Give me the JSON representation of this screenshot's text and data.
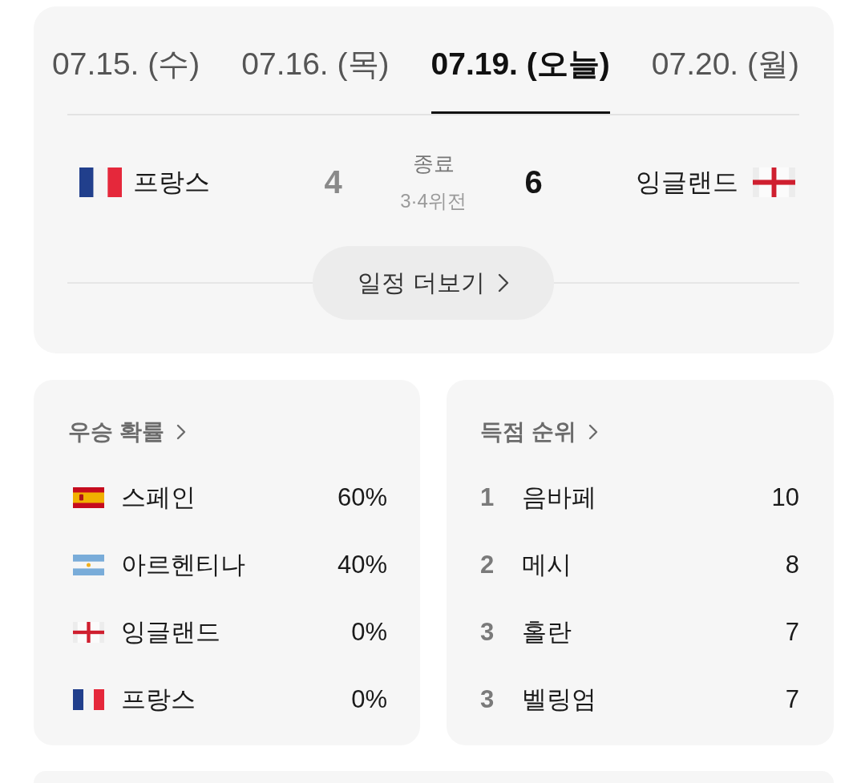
{
  "date_tabs": [
    {
      "label": "07.15. (수)",
      "selected": false
    },
    {
      "label": "07.16. (목)",
      "selected": false
    },
    {
      "label": "07.19. (오늘)",
      "selected": true
    },
    {
      "label": "07.20. (월)",
      "selected": false
    }
  ],
  "match": {
    "home": {
      "kind": "france",
      "name": "프랑스",
      "score": "4",
      "winner": false
    },
    "status": "종료",
    "round": "3·4위전",
    "away": {
      "kind": "england",
      "name": "잉글랜드",
      "score": "6",
      "winner": true
    }
  },
  "schedule_button": {
    "label": "일정 더보기"
  },
  "win_probability": {
    "title": "우승 확률",
    "rows": [
      {
        "kind": "spain",
        "name": "스페인",
        "value": "60%"
      },
      {
        "kind": "argentina",
        "name": "아르헨티나",
        "value": "40%"
      },
      {
        "kind": "england",
        "name": "잉글랜드",
        "value": "0%"
      },
      {
        "kind": "france",
        "name": "프랑스",
        "value": "0%"
      }
    ]
  },
  "top_scorers": {
    "title": "득점 순위",
    "rows": [
      {
        "rank": "1",
        "name": "음바페",
        "goals": "10"
      },
      {
        "rank": "2",
        "name": "메시",
        "goals": "8"
      },
      {
        "rank": "3",
        "name": "홀란",
        "goals": "7"
      },
      {
        "rank": "3",
        "name": "벨링엄",
        "goals": "7"
      }
    ]
  }
}
